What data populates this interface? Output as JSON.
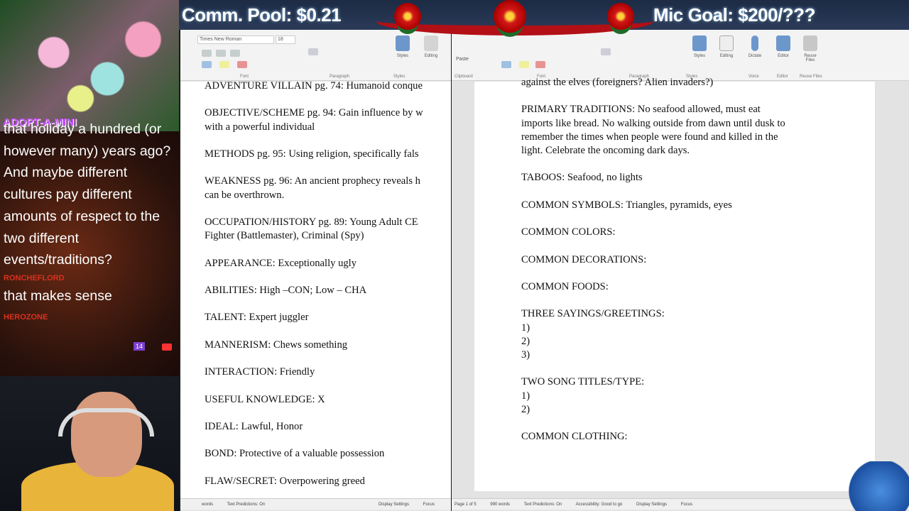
{
  "overlay": {
    "comm_pool": "Comm. Pool: $0.21",
    "mic_goal": "Mic Goal: $200/???",
    "adopt": "ADOPT-A-MINI"
  },
  "chat": {
    "messages": [
      {
        "user": "",
        "text": "that holiday a hundred (or however many) years ago? And maybe different cultures pay different amounts of respect to the two different events/traditions?"
      },
      {
        "user": "RONCHEFLORD",
        "text": "that makes sense"
      },
      {
        "user": "HEROZONE",
        "text": ""
      }
    ],
    "badge": "14"
  },
  "left_doc": {
    "font": "Times New Roman",
    "size": "18",
    "groups": [
      "Font",
      "Paragraph",
      "Styles"
    ],
    "buttons": {
      "styles": "Styles",
      "editing": "Editing"
    },
    "lines": [
      "ADVENTURE VILLAIN pg. 74: Humanoid conque",
      "",
      "OBJECTIVE/SCHEME pg. 94: Gain influence by w",
      "with a powerful individual",
      "",
      "METHODS pg. 95: Using religion, specifically fals",
      "",
      "WEAKNESS pg. 96: An ancient prophecy reveals h",
      "can be overthrown.",
      "",
      "OCCUPATION/HISTORY pg. 89: Young Adult CE",
      "Fighter (Battlemaster), Criminal (Spy)",
      "",
      "APPEARANCE: Exceptionally ugly",
      "",
      "ABILITIES: High –CON; Low – CHA",
      "",
      "TALENT: Expert juggler",
      "",
      "MANNERISM: Chews something",
      "",
      "INTERACTION: Friendly",
      "",
      "USEFUL KNOWLEDGE: X",
      "",
      "IDEAL: Lawful, Honor",
      "",
      "BOND: Protective of a valuable possession",
      "",
      "FLAW/SECRET: Overpowering greed"
    ],
    "status": [
      "words",
      "Text Predictions: On",
      "Display Settings",
      "Focus"
    ]
  },
  "right_doc": {
    "groups": [
      "Clipboard",
      "Font",
      "Paragraph",
      "Styles",
      "Voice",
      "Editor",
      "Reuse Files"
    ],
    "buttons": {
      "paste": "Paste",
      "styles": "Styles",
      "editing": "Editing",
      "dictate": "Dictate",
      "editor": "Editor",
      "reuse": "Reuse Files"
    },
    "lines": [
      "against the elves (foreigners? Alien invaders?)",
      "",
      "PRIMARY TRADITIONS: No seafood allowed, must eat",
      "imports like bread. No walking outside from dawn until dusk to",
      "remember the times when people were found and killed in the",
      "light. Celebrate the oncoming dark days.",
      "",
      "TABOOS: Seafood, no lights",
      "",
      "COMMON SYMBOLS: Triangles, pyramids, eyes",
      "",
      "COMMON COLORS:",
      "",
      "COMMON DECORATIONS:",
      "",
      "COMMON FOODS:",
      "",
      "THREE SAYINGS/GREETINGS:",
      "1)",
      "2)",
      "3)",
      "",
      "TWO SONG TITLES/TYPE:",
      "1)",
      "2)",
      "",
      "COMMON CLOTHING:"
    ],
    "status": [
      "Page 1 of 5",
      "990 words",
      "Text Predictions: On",
      "Accessibility: Good to go",
      "Display Settings",
      "Focus"
    ]
  },
  "colors": {
    "chat_username": "#d9321f",
    "garland": "#b30f16",
    "ribbon": "#f3f3f3"
  }
}
